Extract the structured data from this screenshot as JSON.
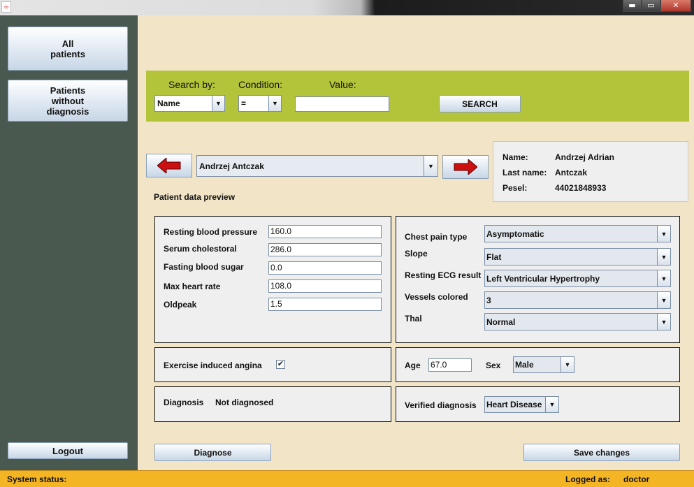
{
  "window": {
    "icon": "java-app-icon",
    "controls": [
      "minimize",
      "maximize",
      "close"
    ],
    "control_glyphs": [
      "▬",
      "▭",
      "✕"
    ]
  },
  "sidebar": {
    "all_patients": [
      "All",
      "patients"
    ],
    "without_diagnosis": [
      "Patients",
      "without",
      "diagnosis"
    ],
    "logout": "Logout"
  },
  "search": {
    "search_by_label": "Search by:",
    "condition_label": "Condition:",
    "value_label": "Value:",
    "search_by_value": "Name",
    "condition_value": "=",
    "value": "",
    "search_button": "SEARCH"
  },
  "navigation": {
    "prev_icon": "left-arrow-icon",
    "next_icon": "right-arrow-icon",
    "selected_patient": "Andrzej Antczak",
    "arrow_color": "#cc1010"
  },
  "patient_info": {
    "name_label": "Name:",
    "name_value": "Andrzej Adrian",
    "last_name_label": "Last name:",
    "last_name_value": "Antczak",
    "pesel_label": "Pesel:",
    "pesel_value": "44021848933"
  },
  "preview_title": "Patient data preview",
  "numeric_fields": {
    "resting_bp_label": "Resting blood pressure",
    "resting_bp_value": "160.0",
    "serum_chol_label": "Serum cholestoral",
    "serum_chol_value": "286.0",
    "fasting_bs_label": "Fasting blood sugar",
    "fasting_bs_value": "0.0",
    "max_hr_label": "Max heart rate",
    "max_hr_value": "108.0",
    "oldpeak_label": "Oldpeak",
    "oldpeak_value": "1.5"
  },
  "categorical_fields": {
    "chest_pain_label": "Chest pain type",
    "chest_pain_value": "Asymptomatic",
    "slope_label": "Slope",
    "slope_value": "Flat",
    "ecg_label": "Resting ECG result",
    "ecg_value": "Left Ventricular Hypertrophy",
    "vessels_label": "Vessels colored",
    "vessels_value": "3",
    "thal_label": "Thal",
    "thal_value": "Normal"
  },
  "angina": {
    "label": "Exercise induced angina",
    "checked": true,
    "check_glyph": "✔"
  },
  "demographics": {
    "age_label": "Age",
    "age_value": "67.0",
    "sex_label": "Sex",
    "sex_value": "Male"
  },
  "diagnosis": {
    "label": "Diagnosis",
    "value": "Not diagnosed"
  },
  "verified": {
    "label": "Verified diagnosis",
    "value": "Heart Disease"
  },
  "actions": {
    "diagnose": "Diagnose",
    "save": "Save changes"
  },
  "status": {
    "system_label": "System status:",
    "logged_label": "Logged as:",
    "user": "doctor"
  },
  "colors": {
    "sidebar": "#49594f",
    "content": "#f2e4c6",
    "search_bar": "#b4c43a",
    "status_bar": "#f3b523"
  }
}
